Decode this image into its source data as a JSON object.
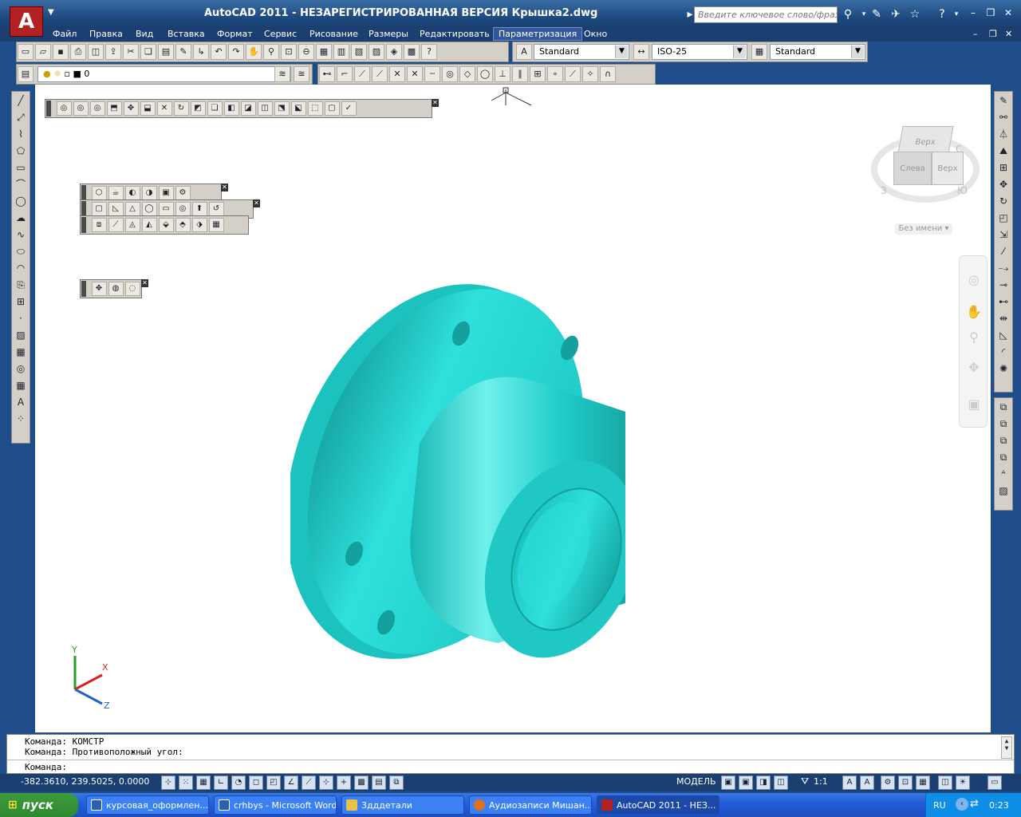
{
  "window": {
    "title": "AutoCAD 2011 - НЕЗАРЕГИСТРИРОВАННАЯ ВЕРСИЯ    Крышка2.dwg",
    "logo": "A",
    "search_placeholder": "Введите ключевое слово/фразу"
  },
  "menu": {
    "items": [
      "Файл",
      "Правка",
      "Вид",
      "Вставка",
      "Формат",
      "Сервис",
      "Рисование",
      "Размеры",
      "Редактировать",
      "Параметризация",
      "Окно"
    ],
    "active_index": 9
  },
  "toolbar": {
    "text_style": "Standard",
    "dim_style": "ISO-25",
    "table_style": "Standard",
    "layer": "0"
  },
  "viewcube": {
    "top_label": "Верх",
    "front_label": "Слева",
    "side_label": "Верх",
    "compass_w": "З",
    "compass_s": "Ю",
    "compass_n": "С",
    "view_name": "Без имени"
  },
  "ucs": {
    "x_label": "X",
    "y_label": "Y",
    "z_label": "Z"
  },
  "command": {
    "line1": "Команда:  КОМСТР",
    "line2": "Команда:  Противоположный угол:",
    "prompt": "Команда:"
  },
  "status": {
    "coords": "-382.3610, 239.5025, 0.0000",
    "model": "МОДЕЛЬ",
    "scale": "1:1"
  },
  "taskbar": {
    "start": "пуск",
    "tasks": [
      {
        "label": "курсовая_оформлен...",
        "color": "#2b5fb8"
      },
      {
        "label": "crhbys - Microsoft Word",
        "color": "#2b5fb8"
      },
      {
        "label": "3дддетали",
        "color": "#e8c24a"
      },
      {
        "label": "Аудиозаписи Мишан...",
        "color": "#e0701c"
      },
      {
        "label": "AutoCAD 2011 - НЕЗ...",
        "color": "#b22222"
      }
    ],
    "lang": "RU",
    "clock": "0:23"
  },
  "colors": {
    "part": "#1fc8c4",
    "part_dark": "#17a9a6",
    "part_light": "#6ff0ec",
    "canvas": "#ffffff"
  }
}
